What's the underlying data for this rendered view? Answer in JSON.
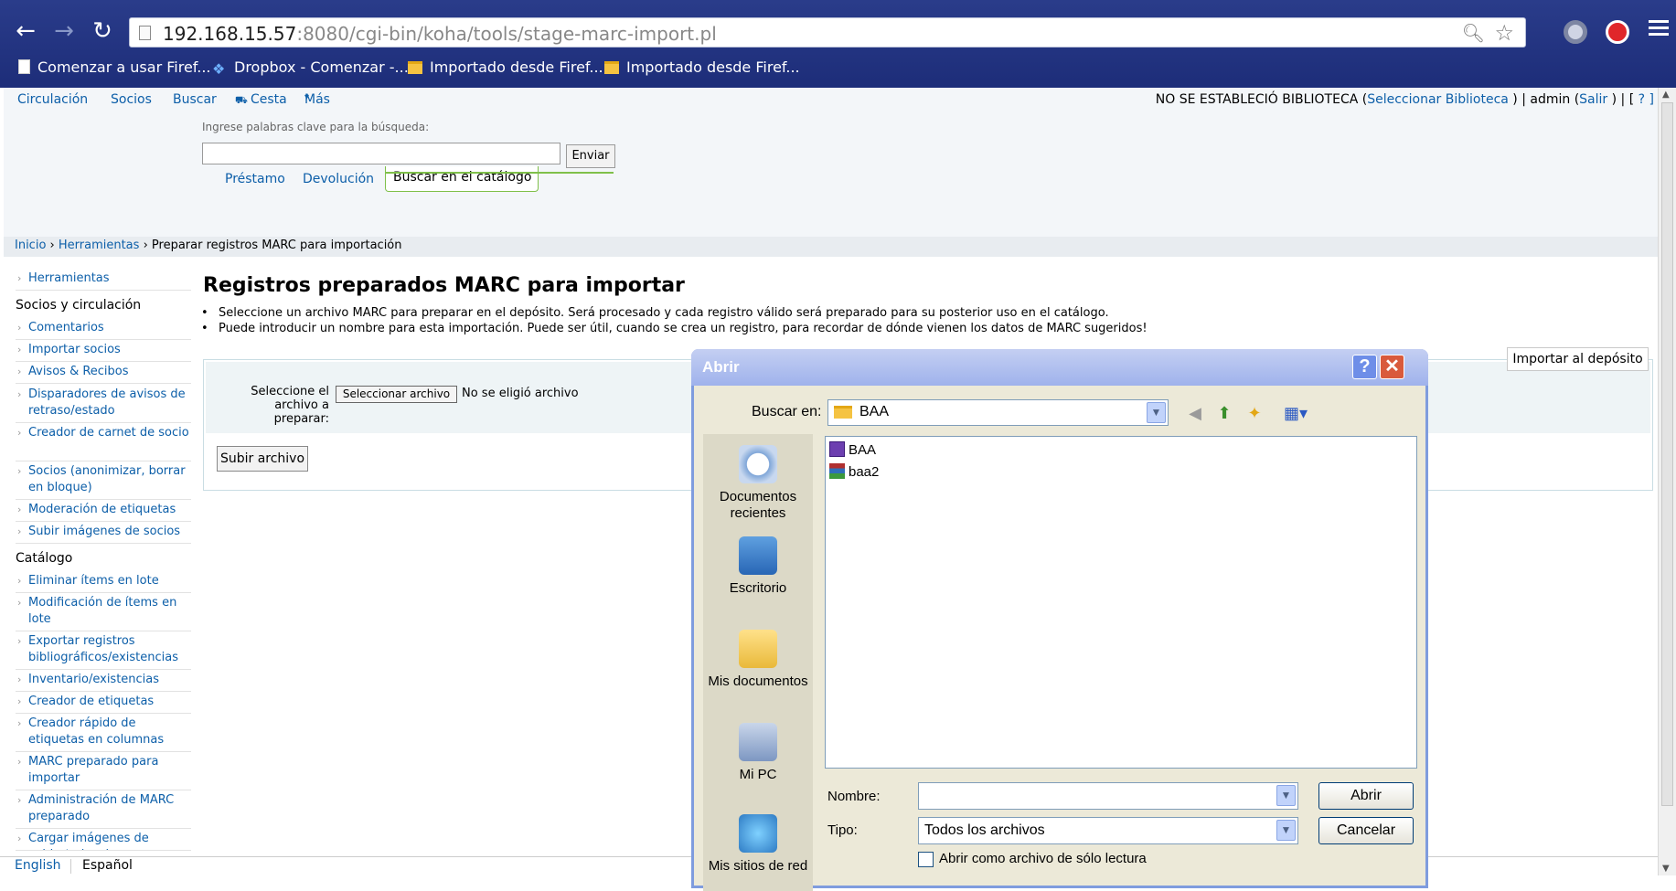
{
  "browser": {
    "url_host": "192.168.15.57",
    "url_rest": ":8080/cgi-bin/koha/tools/stage-marc-import.pl",
    "bookmarks": [
      {
        "label": "Comenzar a usar Firef..."
      },
      {
        "label": "Dropbox - Comenzar -..."
      },
      {
        "label": "Importado desde Firef..."
      },
      {
        "label": "Importado desde Firef..."
      }
    ]
  },
  "topnav": {
    "items": [
      "Circulación",
      "Socios",
      "Buscar",
      "Cesta",
      "Más"
    ],
    "right_prefix": "NO SE ESTABLECIÓ BIBLIOTECA (",
    "right_link": "Seleccionar Biblioteca",
    "right_mid": " ) | admin (",
    "right_logout": "Salir",
    "right_end": " ) | [",
    "right_help": " ? ",
    "right_close": "]"
  },
  "search": {
    "label": "Ingrese palabras clave para la búsqueda:",
    "value": "",
    "submit": "Enviar",
    "tabs": [
      "Préstamo",
      "Devolución"
    ],
    "active_tab": "Buscar en el catálogo"
  },
  "breadcrumbs": {
    "home": "Inicio",
    "sep1": " › ",
    "tools": "Herramientas",
    "sep2": " › ",
    "current": "Preparar registros MARC para importación"
  },
  "sidebar": {
    "top": "Herramientas",
    "section1": "Socios y circulación",
    "items1": [
      "Comentarios",
      "Importar socios",
      "Avisos & Recibos",
      "Disparadores de avisos de retraso/estado",
      "Creador de carnet de socio",
      "Socios (anonimizar, borrar en bloque)",
      "Moderación de etiquetas",
      "Subir imágenes de socios"
    ],
    "section2": "Catálogo",
    "items2": [
      "Eliminar ítems en lote",
      "Modificación de ítems en lote",
      "Exportar registros bibliográficos/existencias",
      "Inventario/existencias",
      "Creador de etiquetas",
      "Creador rápido de etiquetas en columnas",
      "MARC preparado para importar",
      "Administración de MARC preparado",
      "Cargar imágenes de cubierta locales"
    ]
  },
  "main": {
    "title": "Registros preparados MARC para importar",
    "bullets": [
      "Seleccione un archivo MARC para preparar en el depósito. Será procesado y cada registro válido será preparado para su posterior uso en el catálogo.",
      "Puede introducir un nombre para esta importación. Puede ser útil, cuando se crea un registro, para recordar de dónde vienen los datos de MARC sugeridos!"
    ],
    "import_button": "Importar al depósito",
    "select_label": "Seleccione el archivo a preparar:",
    "file_button": "Seleccionar archivo",
    "no_file": "No se eligió archivo",
    "upload_button": "Subir archivo"
  },
  "languages": [
    "English",
    "Español"
  ],
  "dialog": {
    "title": "Abrir",
    "help": "?",
    "close": "✕",
    "lookin_label": "Buscar en:",
    "lookin_value": "BAA",
    "places": [
      "Documentos recientes",
      "Escritorio",
      "Mis documentos",
      "Mi PC",
      "Mis sitios de red"
    ],
    "files": [
      {
        "name": "BAA",
        "icon": "marc-file-icon"
      },
      {
        "name": "baa2",
        "icon": "rar-archive-icon"
      }
    ],
    "name_label": "Nombre:",
    "name_value": "",
    "type_label": "Tipo:",
    "type_value": "Todos los archivos",
    "open_button": "Abrir",
    "cancel_button": "Cancelar",
    "readonly_label": "Abrir como archivo de sólo lectura"
  }
}
